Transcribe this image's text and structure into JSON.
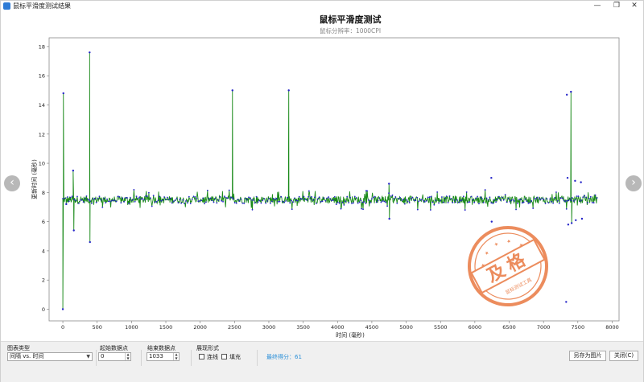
{
  "window": {
    "title": "鼠标平滑度测试结果",
    "min_glyph": "—",
    "max_glyph": "❐",
    "close_glyph": "✕"
  },
  "nav": {
    "prev_glyph": "‹",
    "next_glyph": "›"
  },
  "chart_data": {
    "type": "scatter",
    "title": "鼠标平滑度测试",
    "subtitle": "鼠标分辨率：1000CPI",
    "xlabel": "时间 (毫秒)",
    "ylabel": "更新时间 (毫秒)",
    "xlim": [
      -200,
      8100
    ],
    "ylim": [
      -0.8,
      18.6
    ],
    "x_ticks": [
      0,
      500,
      1000,
      1500,
      2000,
      2500,
      3000,
      3500,
      4000,
      4500,
      5000,
      5500,
      6000,
      6500,
      7000,
      7500,
      8000
    ],
    "y_ticks": [
      0,
      2,
      4,
      6,
      8,
      10,
      12,
      14,
      16,
      18
    ],
    "grid": true,
    "line_color": "#1a8a1a",
    "point_color": "#2424c8",
    "baseline": 7.5,
    "x_end": 7790,
    "spikes": [
      {
        "x": 0,
        "y": 0.0
      },
      {
        "x": 8,
        "y": 14.8
      },
      {
        "x": 50,
        "y": 7.2
      },
      {
        "x": 150,
        "y": 9.5
      },
      {
        "x": 160,
        "y": 5.4
      },
      {
        "x": 390,
        "y": 17.6
      },
      {
        "x": 395,
        "y": 4.6
      },
      {
        "x": 2470,
        "y": 15.0
      },
      {
        "x": 3290,
        "y": 15.0
      },
      {
        "x": 4750,
        "y": 8.6
      },
      {
        "x": 4755,
        "y": 6.2
      },
      {
        "x": 7400,
        "y": 14.9
      },
      {
        "x": 7410,
        "y": 5.9
      }
    ],
    "outliers": [
      {
        "x": 6240,
        "y": 9.0
      },
      {
        "x": 6245,
        "y": 6.0
      },
      {
        "x": 7340,
        "y": 14.7
      },
      {
        "x": 7350,
        "y": 9.0
      },
      {
        "x": 7360,
        "y": 5.8
      },
      {
        "x": 7330,
        "y": 0.5
      },
      {
        "x": 7460,
        "y": 8.8
      },
      {
        "x": 7470,
        "y": 6.1
      },
      {
        "x": 7545,
        "y": 8.7
      },
      {
        "x": 7560,
        "y": 6.2
      }
    ]
  },
  "stamp": {
    "text": "及格",
    "subtext": "鼠标测试工具",
    "color": "#e8743a"
  },
  "controls": {
    "chart_type_label": "图表类型",
    "chart_type_value": "间隔 vs. 时间",
    "start_label": "起始数据点",
    "start_value": "0",
    "end_label": "结束数据点",
    "end_value": "1033",
    "display_label": "展现形式",
    "connect_label": "连线",
    "fill_label": "填充",
    "score_text": "最终得分：61",
    "save_label": "另存为图片",
    "close_label": "关闭(C)"
  }
}
